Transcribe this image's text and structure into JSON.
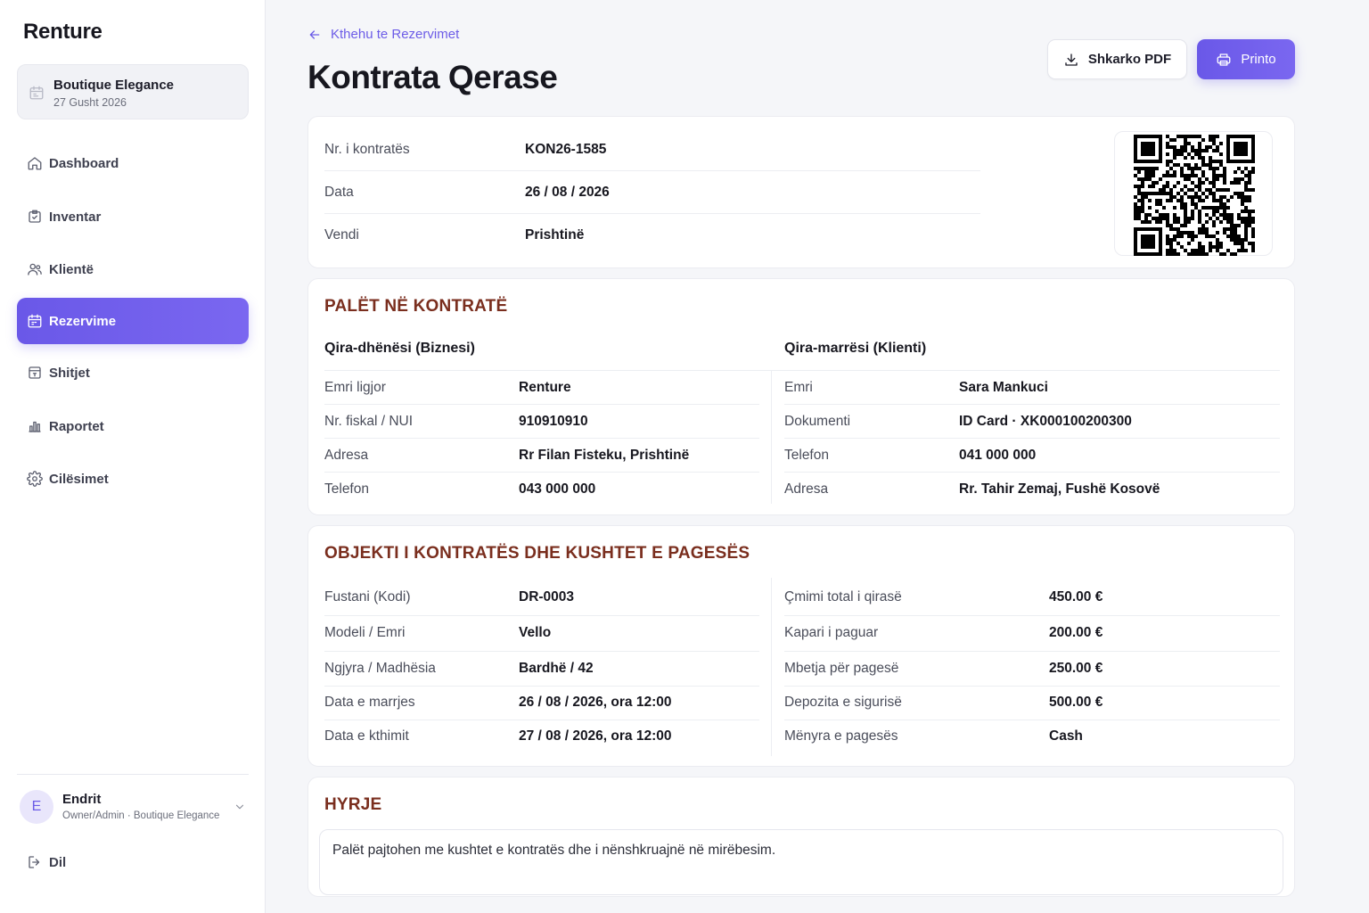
{
  "app": {
    "name": "Renture"
  },
  "store": {
    "name": "Boutique Elegance",
    "date": "27 Gusht 2026"
  },
  "nav": [
    {
      "label": "Dashboard",
      "icon": "home-icon",
      "active": false
    },
    {
      "label": "Inventar",
      "icon": "inventory-icon",
      "active": false
    },
    {
      "label": "Klientë",
      "icon": "users-icon",
      "active": false
    },
    {
      "label": "Rezervime",
      "icon": "calendar-icon",
      "active": true
    },
    {
      "label": "Shitjet",
      "icon": "sales-icon",
      "active": false
    },
    {
      "label": "Raportet",
      "icon": "chart-icon",
      "active": false
    },
    {
      "label": "Cilësimet",
      "icon": "gear-icon",
      "active": false
    }
  ],
  "user": {
    "initial": "E",
    "name": "Endrit",
    "role": "Owner/Admin · Boutique Elegance"
  },
  "logout": {
    "label": "Dil"
  },
  "header": {
    "back_label": "Kthehu te Rezervimet",
    "title": "Kontrata Qerase",
    "pdf_label": "Shkarko PDF",
    "print_label": "Printo"
  },
  "colors": {
    "accent": "#6c5ce7",
    "section_title": "#7a2e1e"
  },
  "contract_info": [
    {
      "label": "Nr. i kontratës",
      "value": "KON26-1585"
    },
    {
      "label": "Data",
      "value": "26 / 08 / 2026"
    },
    {
      "label": "Vendi",
      "value": "Prishtinë"
    }
  ],
  "parties": {
    "title": "PALËT NË KONTRATË",
    "lessor": {
      "title": "Qira-dhënësi (Biznesi)",
      "rows": [
        {
          "label": "Emri ligjor",
          "value": "Renture"
        },
        {
          "label": "Nr. fiskal / NUI",
          "value": "910910910"
        },
        {
          "label": "Adresa",
          "value": "Rr Filan Fisteku, Prishtinë"
        },
        {
          "label": "Telefon",
          "value": "043 000 000"
        }
      ]
    },
    "lessee": {
      "title": "Qira-marrësi (Klienti)",
      "rows": [
        {
          "label": "Emri",
          "value": "Sara Mankuci"
        },
        {
          "label": "Dokumenti",
          "value": "ID Card · XK000100200300"
        },
        {
          "label": "Telefon",
          "value": "041 000 000"
        },
        {
          "label": "Adresa",
          "value": "Rr. Tahir Zemaj, Fushë Kosovë"
        }
      ]
    }
  },
  "object": {
    "title": "OBJEKTI I KONTRATËS DHE KUSHTET E PAGESËS",
    "left": [
      {
        "label": "Fustani (Kodi)",
        "value": "DR-0003"
      },
      {
        "label": "Modeli / Emri",
        "value": "Vello"
      },
      {
        "label": "Ngjyra / Madhësia",
        "value": "Bardhë / 42"
      },
      {
        "label": "Data e marrjes",
        "value": "26 / 08 / 2026, ora 12:00"
      },
      {
        "label": "Data e kthimit",
        "value": "27 / 08 / 2026, ora 12:00"
      }
    ],
    "right": [
      {
        "label": "Çmimi total i qirasë",
        "value": "450.00 €"
      },
      {
        "label": "Kapari i paguar",
        "value": "200.00 €"
      },
      {
        "label": "Mbetja për pagesë",
        "value": "250.00 €"
      },
      {
        "label": "Depozita e sigurisë",
        "value": "500.00 €"
      },
      {
        "label": "Mënyra e pagesës",
        "value": "Cash"
      }
    ]
  },
  "intro": {
    "title": "HYRJE",
    "text": "Palët pajtohen me kushtet e kontratës dhe i nënshkruajnë në mirëbesim."
  }
}
